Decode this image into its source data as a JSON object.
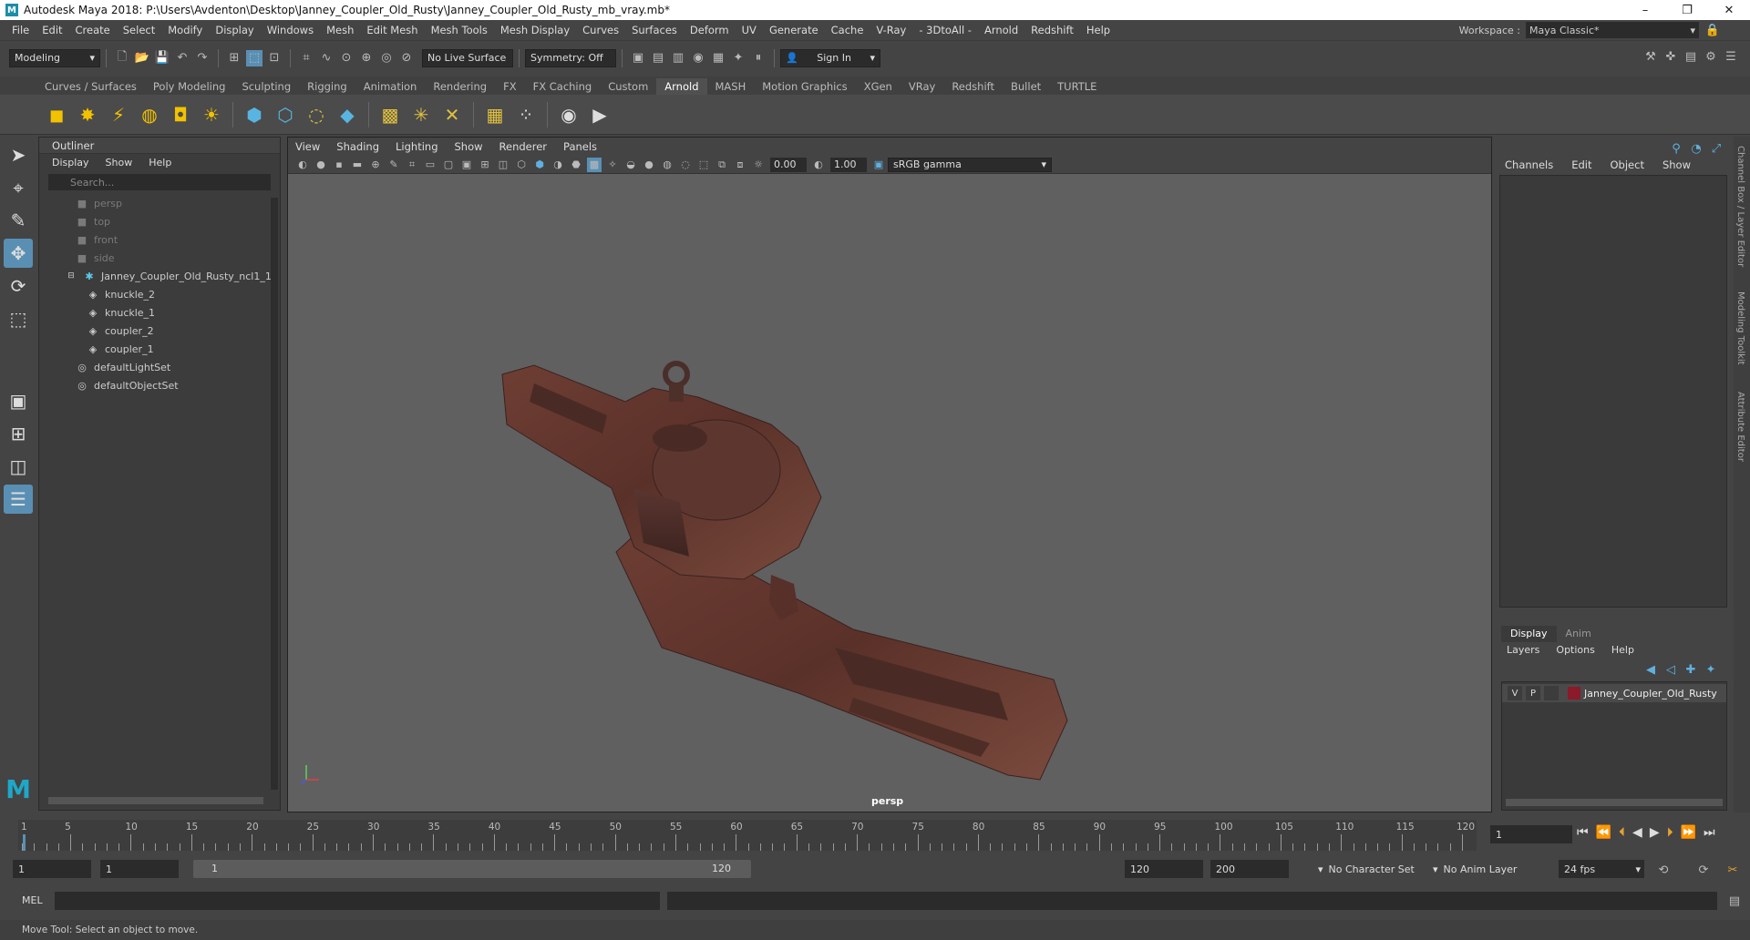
{
  "window": {
    "title": "Autodesk Maya 2018: P:\\Users\\Avdenton\\Desktop\\Janney_Coupler_Old_Rusty\\Janney_Coupler_Old_Rusty_mb_vray.mb*",
    "logo": "M",
    "minimize": "–",
    "restore": "❐",
    "close": "✕"
  },
  "menubar": {
    "items": [
      "File",
      "Edit",
      "Create",
      "Select",
      "Modify",
      "Display",
      "Windows",
      "Mesh",
      "Edit Mesh",
      "Mesh Tools",
      "Mesh Display",
      "Curves",
      "Surfaces",
      "Deform",
      "UV",
      "Generate",
      "Cache",
      "V-Ray",
      "- 3DtoAll -",
      "Arnold",
      "Redshift",
      "Help"
    ],
    "workspace_label": "Workspace :",
    "workspace_value": "Maya Classic*"
  },
  "statusline": {
    "mode": "Modeling",
    "live_surface": "No Live Surface",
    "symmetry": "Symmetry: Off",
    "sign_in": "Sign In"
  },
  "shelf": {
    "tabs": [
      "Curves / Surfaces",
      "Poly Modeling",
      "Sculpting",
      "Rigging",
      "Animation",
      "Rendering",
      "FX",
      "FX Caching",
      "Custom",
      "Arnold",
      "MASH",
      "Motion Graphics",
      "XGen",
      "VRay",
      "Redshift",
      "Bullet",
      "TURTLE"
    ],
    "active_tab": "Arnold"
  },
  "outliner": {
    "title": "Outliner",
    "menu": [
      "Display",
      "Show",
      "Help"
    ],
    "search_placeholder": "Search...",
    "cameras": [
      "persp",
      "top",
      "front",
      "side"
    ],
    "group": "Janney_Coupler_Old_Rusty_ncl1_1",
    "meshes": [
      "knuckle_2",
      "knuckle_1",
      "coupler_2",
      "coupler_1"
    ],
    "sets": [
      "defaultLightSet",
      "defaultObjectSet"
    ]
  },
  "viewport": {
    "menu": [
      "View",
      "Shading",
      "Lighting",
      "Show",
      "Renderer",
      "Panels"
    ],
    "exposure": "0.00",
    "gamma": "1.00",
    "color_space": "sRGB gamma",
    "camera": "persp"
  },
  "channelbox": {
    "menu": [
      "Channels",
      "Edit",
      "Object",
      "Show"
    ]
  },
  "layers": {
    "tabs": [
      "Display",
      "Anim"
    ],
    "menu": [
      "Layers",
      "Options",
      "Help"
    ],
    "rows": [
      {
        "v": "V",
        "p": "P",
        "name": "Janney_Coupler_Old_Rusty",
        "color": "#8b1a2a"
      }
    ]
  },
  "sidetabs": [
    "Channel Box / Layer Editor",
    "Modeling Toolkit",
    "Attribute Editor"
  ],
  "timeline": {
    "ticks": [
      "5",
      "10",
      "15",
      "20",
      "25",
      "30",
      "35",
      "40",
      "45",
      "50",
      "55",
      "60",
      "65",
      "70",
      "75",
      "80",
      "85",
      "90",
      "95",
      "100",
      "105",
      "110",
      "115",
      "120"
    ],
    "first": "1",
    "current_frame": "1"
  },
  "range": {
    "start": "1",
    "playback_start": "1",
    "slider_start": "1",
    "slider_end": "120",
    "playback_end": "120",
    "end": "200",
    "character_set": "No Character Set",
    "anim_layer": "No Anim Layer",
    "fps": "24 fps"
  },
  "cmdline": {
    "label": "MEL"
  },
  "helpline": {
    "text": "Move Tool: Select an object to move."
  }
}
